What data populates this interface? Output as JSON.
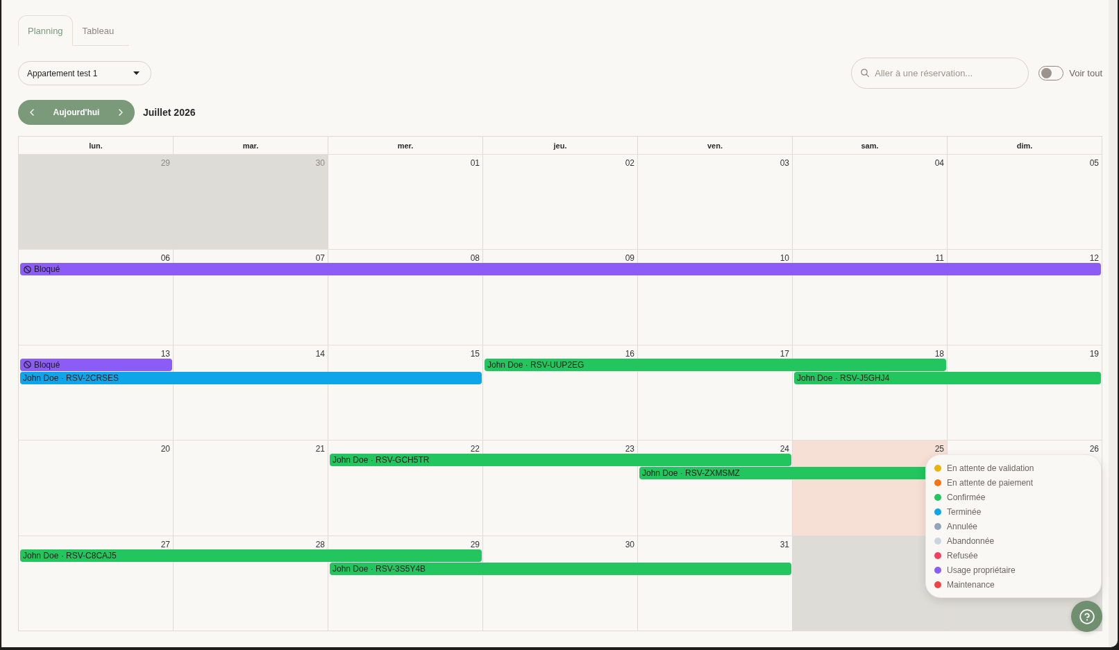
{
  "tabs": [
    {
      "label": "Planning",
      "selected": true
    },
    {
      "label": "Tableau",
      "selected": false
    }
  ],
  "property_select": {
    "value": "Appartement test 1"
  },
  "search": {
    "placeholder": "Aller à une réservation..."
  },
  "show_all": {
    "label": "Voir tout",
    "on": false
  },
  "navigation": {
    "today_label": "Aujourd'hui",
    "month_title": "Juillet 2026"
  },
  "calendar": {
    "weekdays": [
      "lun.",
      "mar.",
      "mer.",
      "jeu.",
      "ven.",
      "sam.",
      "dim."
    ],
    "weeks": [
      {
        "days": [
          {
            "date": "29",
            "outside_month": true,
            "today": false
          },
          {
            "date": "30",
            "outside_month": true,
            "today": false
          },
          {
            "date": "01",
            "outside_month": false,
            "today": false
          },
          {
            "date": "02",
            "outside_month": false,
            "today": false
          },
          {
            "date": "03",
            "outside_month": false,
            "today": false
          },
          {
            "date": "04",
            "outside_month": false,
            "today": false
          },
          {
            "date": "05",
            "outside_month": false,
            "today": false
          }
        ]
      },
      {
        "days": [
          {
            "date": "06",
            "outside_month": false,
            "today": false
          },
          {
            "date": "07",
            "outside_month": false,
            "today": false
          },
          {
            "date": "08",
            "outside_month": false,
            "today": false
          },
          {
            "date": "09",
            "outside_month": false,
            "today": false
          },
          {
            "date": "10",
            "outside_month": false,
            "today": false
          },
          {
            "date": "11",
            "outside_month": false,
            "today": false
          },
          {
            "date": "12",
            "outside_month": false,
            "today": false
          }
        ],
        "lanes": [
          [
            {
              "kind": "blocked",
              "label": "Bloqué",
              "color": "#8b5cf6"
            },
            {
              "kind": "continued"
            },
            {
              "kind": "continued"
            },
            {
              "kind": "continued"
            },
            {
              "kind": "continued"
            },
            {
              "kind": "continued"
            },
            {
              "kind": "continued"
            }
          ]
        ]
      },
      {
        "days": [
          {
            "date": "13",
            "outside_month": false,
            "today": false
          },
          {
            "date": "14",
            "outside_month": false,
            "today": false
          },
          {
            "date": "15",
            "outside_month": false,
            "today": false
          },
          {
            "date": "16",
            "outside_month": false,
            "today": false
          },
          {
            "date": "17",
            "outside_month": false,
            "today": false
          },
          {
            "date": "18",
            "outside_month": false,
            "today": false
          },
          {
            "date": "19",
            "outside_month": false,
            "today": false
          }
        ],
        "lanes": [
          [
            {
              "kind": "blocked",
              "label": "Bloqué",
              "color": "#8b5cf6"
            },
            {
              "kind": "free"
            },
            {
              "kind": "free"
            },
            {
              "kind": "reservation",
              "label": "John Doe · RSV-UUP2EG",
              "color": "#22c55e"
            },
            {
              "kind": "continued"
            },
            {
              "kind": "continued"
            },
            {
              "kind": "free"
            }
          ],
          [
            {
              "kind": "reservation",
              "label": "John Doe · RSV-2CRSES",
              "color": "#0ea5e9"
            },
            {
              "kind": "continued"
            },
            {
              "kind": "continued"
            },
            {
              "kind": "free"
            },
            {
              "kind": "free"
            },
            {
              "kind": "reservation",
              "label": "John Doe · RSV-J5GHJ4",
              "color": "#22c55e"
            },
            {
              "kind": "continued"
            }
          ]
        ]
      },
      {
        "days": [
          {
            "date": "20",
            "outside_month": false,
            "today": false
          },
          {
            "date": "21",
            "outside_month": false,
            "today": false
          },
          {
            "date": "22",
            "outside_month": false,
            "today": false
          },
          {
            "date": "23",
            "outside_month": false,
            "today": false
          },
          {
            "date": "24",
            "outside_month": false,
            "today": false
          },
          {
            "date": "25",
            "outside_month": false,
            "today": true
          },
          {
            "date": "26",
            "outside_month": false,
            "today": false
          }
        ],
        "lanes": [
          [
            {
              "kind": "free"
            },
            {
              "kind": "free"
            },
            {
              "kind": "reservation",
              "label": "John Doe · RSV-GCH5TR",
              "color": "#22c55e"
            },
            {
              "kind": "continued"
            },
            {
              "kind": "continued"
            },
            {
              "kind": "free"
            },
            {
              "kind": "free"
            }
          ],
          [
            {
              "kind": "free"
            },
            {
              "kind": "free"
            },
            {
              "kind": "free"
            },
            {
              "kind": "free"
            },
            {
              "kind": "reservation",
              "label": "John Doe · RSV-ZXMSMZ",
              "color": "#22c55e"
            },
            {
              "kind": "continued"
            },
            {
              "kind": "free"
            }
          ]
        ]
      },
      {
        "days": [
          {
            "date": "27",
            "outside_month": false,
            "today": false
          },
          {
            "date": "28",
            "outside_month": false,
            "today": false
          },
          {
            "date": "29",
            "outside_month": false,
            "today": false
          },
          {
            "date": "30",
            "outside_month": false,
            "today": false
          },
          {
            "date": "31",
            "outside_month": false,
            "today": false
          },
          {
            "outside_month": true,
            "today": false
          },
          {
            "outside_month": true,
            "today": false
          }
        ],
        "lanes": [
          [
            {
              "kind": "reservation",
              "label": "John Doe · RSV-C8CAJ5",
              "color": "#22c55e"
            },
            {
              "kind": "continued"
            },
            {
              "kind": "continued"
            },
            {
              "kind": "free"
            },
            {
              "kind": "free"
            },
            {
              "kind": "free"
            },
            {
              "kind": "free"
            }
          ],
          [
            {
              "kind": "free"
            },
            {
              "kind": "free"
            },
            {
              "kind": "reservation",
              "label": "John Doe · RSV-3S5Y4B",
              "color": "#22c55e"
            },
            {
              "kind": "continued"
            },
            {
              "kind": "continued"
            },
            {
              "kind": "free"
            },
            {
              "kind": "free"
            }
          ]
        ]
      }
    ]
  },
  "legend": {
    "items": [
      {
        "label": "En attente de validation",
        "color": "#eab308"
      },
      {
        "label": "En attente de paiement",
        "color": "#f97316"
      },
      {
        "label": "Confirmée",
        "color": "#22c55e"
      },
      {
        "label": "Terminée",
        "color": "#0ea5e9"
      },
      {
        "label": "Annulée",
        "color": "#94a3b8"
      },
      {
        "label": "Abandonnée",
        "color": "#cbd5e1"
      },
      {
        "label": "Refusée",
        "color": "#f43f5e"
      },
      {
        "label": "Usage propriétaire",
        "color": "#8b5cf6"
      },
      {
        "label": "Maintenance",
        "color": "#ef4444"
      }
    ]
  }
}
